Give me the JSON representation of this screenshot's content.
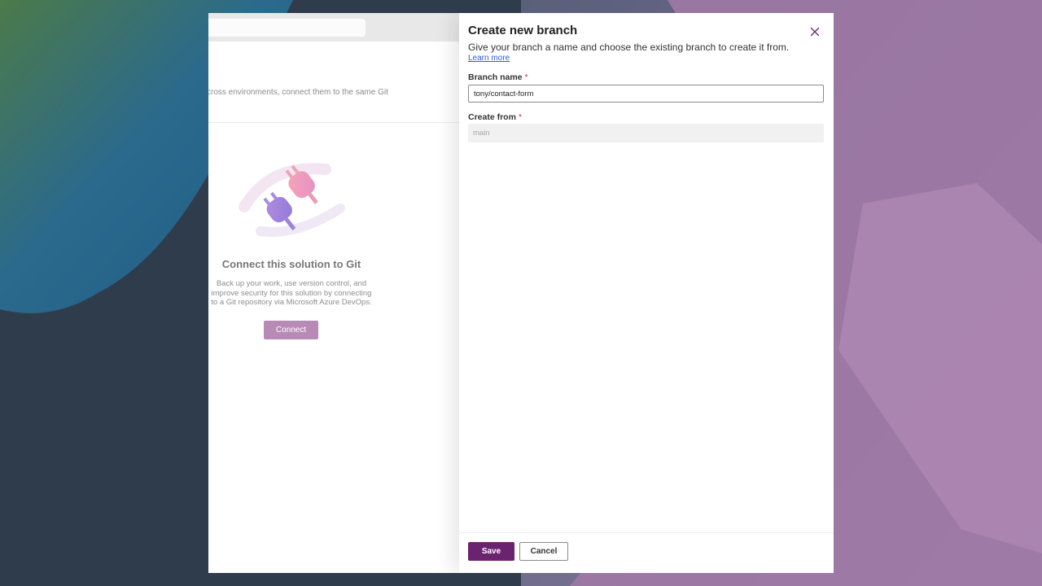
{
  "background_page": {
    "description_fragment": "cross environments, connect them to the same Git",
    "empty_state": {
      "title": "Connect this solution to Git",
      "description_line1": "Back up your work, use version control, and",
      "description_line2": "improve security for this solution by connecting",
      "description_line3": "to a Git repository via Microsoft Azure DevOps.",
      "connect_label": "Connect"
    }
  },
  "panel": {
    "title": "Create new branch",
    "subtitle": "Give your branch a name and choose the existing branch to create it from.",
    "learn_more": "Learn more",
    "branch_name": {
      "label": "Branch name",
      "required_mark": "*",
      "value": "tony/contact-form"
    },
    "create_from": {
      "label": "Create from",
      "required_mark": "*",
      "value": "main"
    },
    "save_label": "Save",
    "cancel_label": "Cancel"
  },
  "colors": {
    "primary": "#6b2370",
    "connect_button": "#b78bb6",
    "link": "#2e5bd8",
    "required": "#c4314b"
  },
  "icons": {
    "close": "close-icon",
    "illustration": "plug-illustration"
  }
}
